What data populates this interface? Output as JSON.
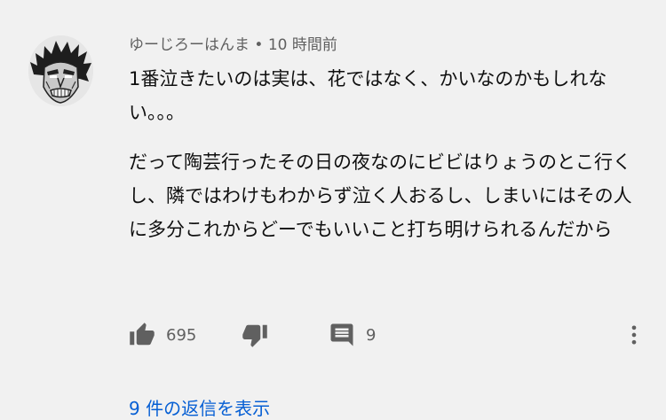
{
  "comment": {
    "author": "ゆーじろーはんま",
    "separator": "•",
    "time": "10 時間前",
    "paragraphs": [
      "1番泣きたいのは実は、花ではなく、かいなのかもしれない。。。",
      "だって陶芸行ったその日の夜なのにビビはりょうのとこ行くし、隣ではわけもわからず泣く人おるし、しまいにはその人に多分これからどーでもいいこと打ち明けられるんだから"
    ]
  },
  "actions": {
    "like_count": "695",
    "reply_count": "9",
    "icons": {
      "like": "thumbs-up-icon",
      "dislike": "thumbs-down-icon",
      "reply": "comment-icon",
      "more": "more-vert-icon"
    }
  },
  "replies": {
    "label": "9 件の返信を表示"
  },
  "colors": {
    "background": "#f1f1f1",
    "text": "#0f0f0f",
    "secondary": "#606060",
    "link": "#065fd4"
  }
}
